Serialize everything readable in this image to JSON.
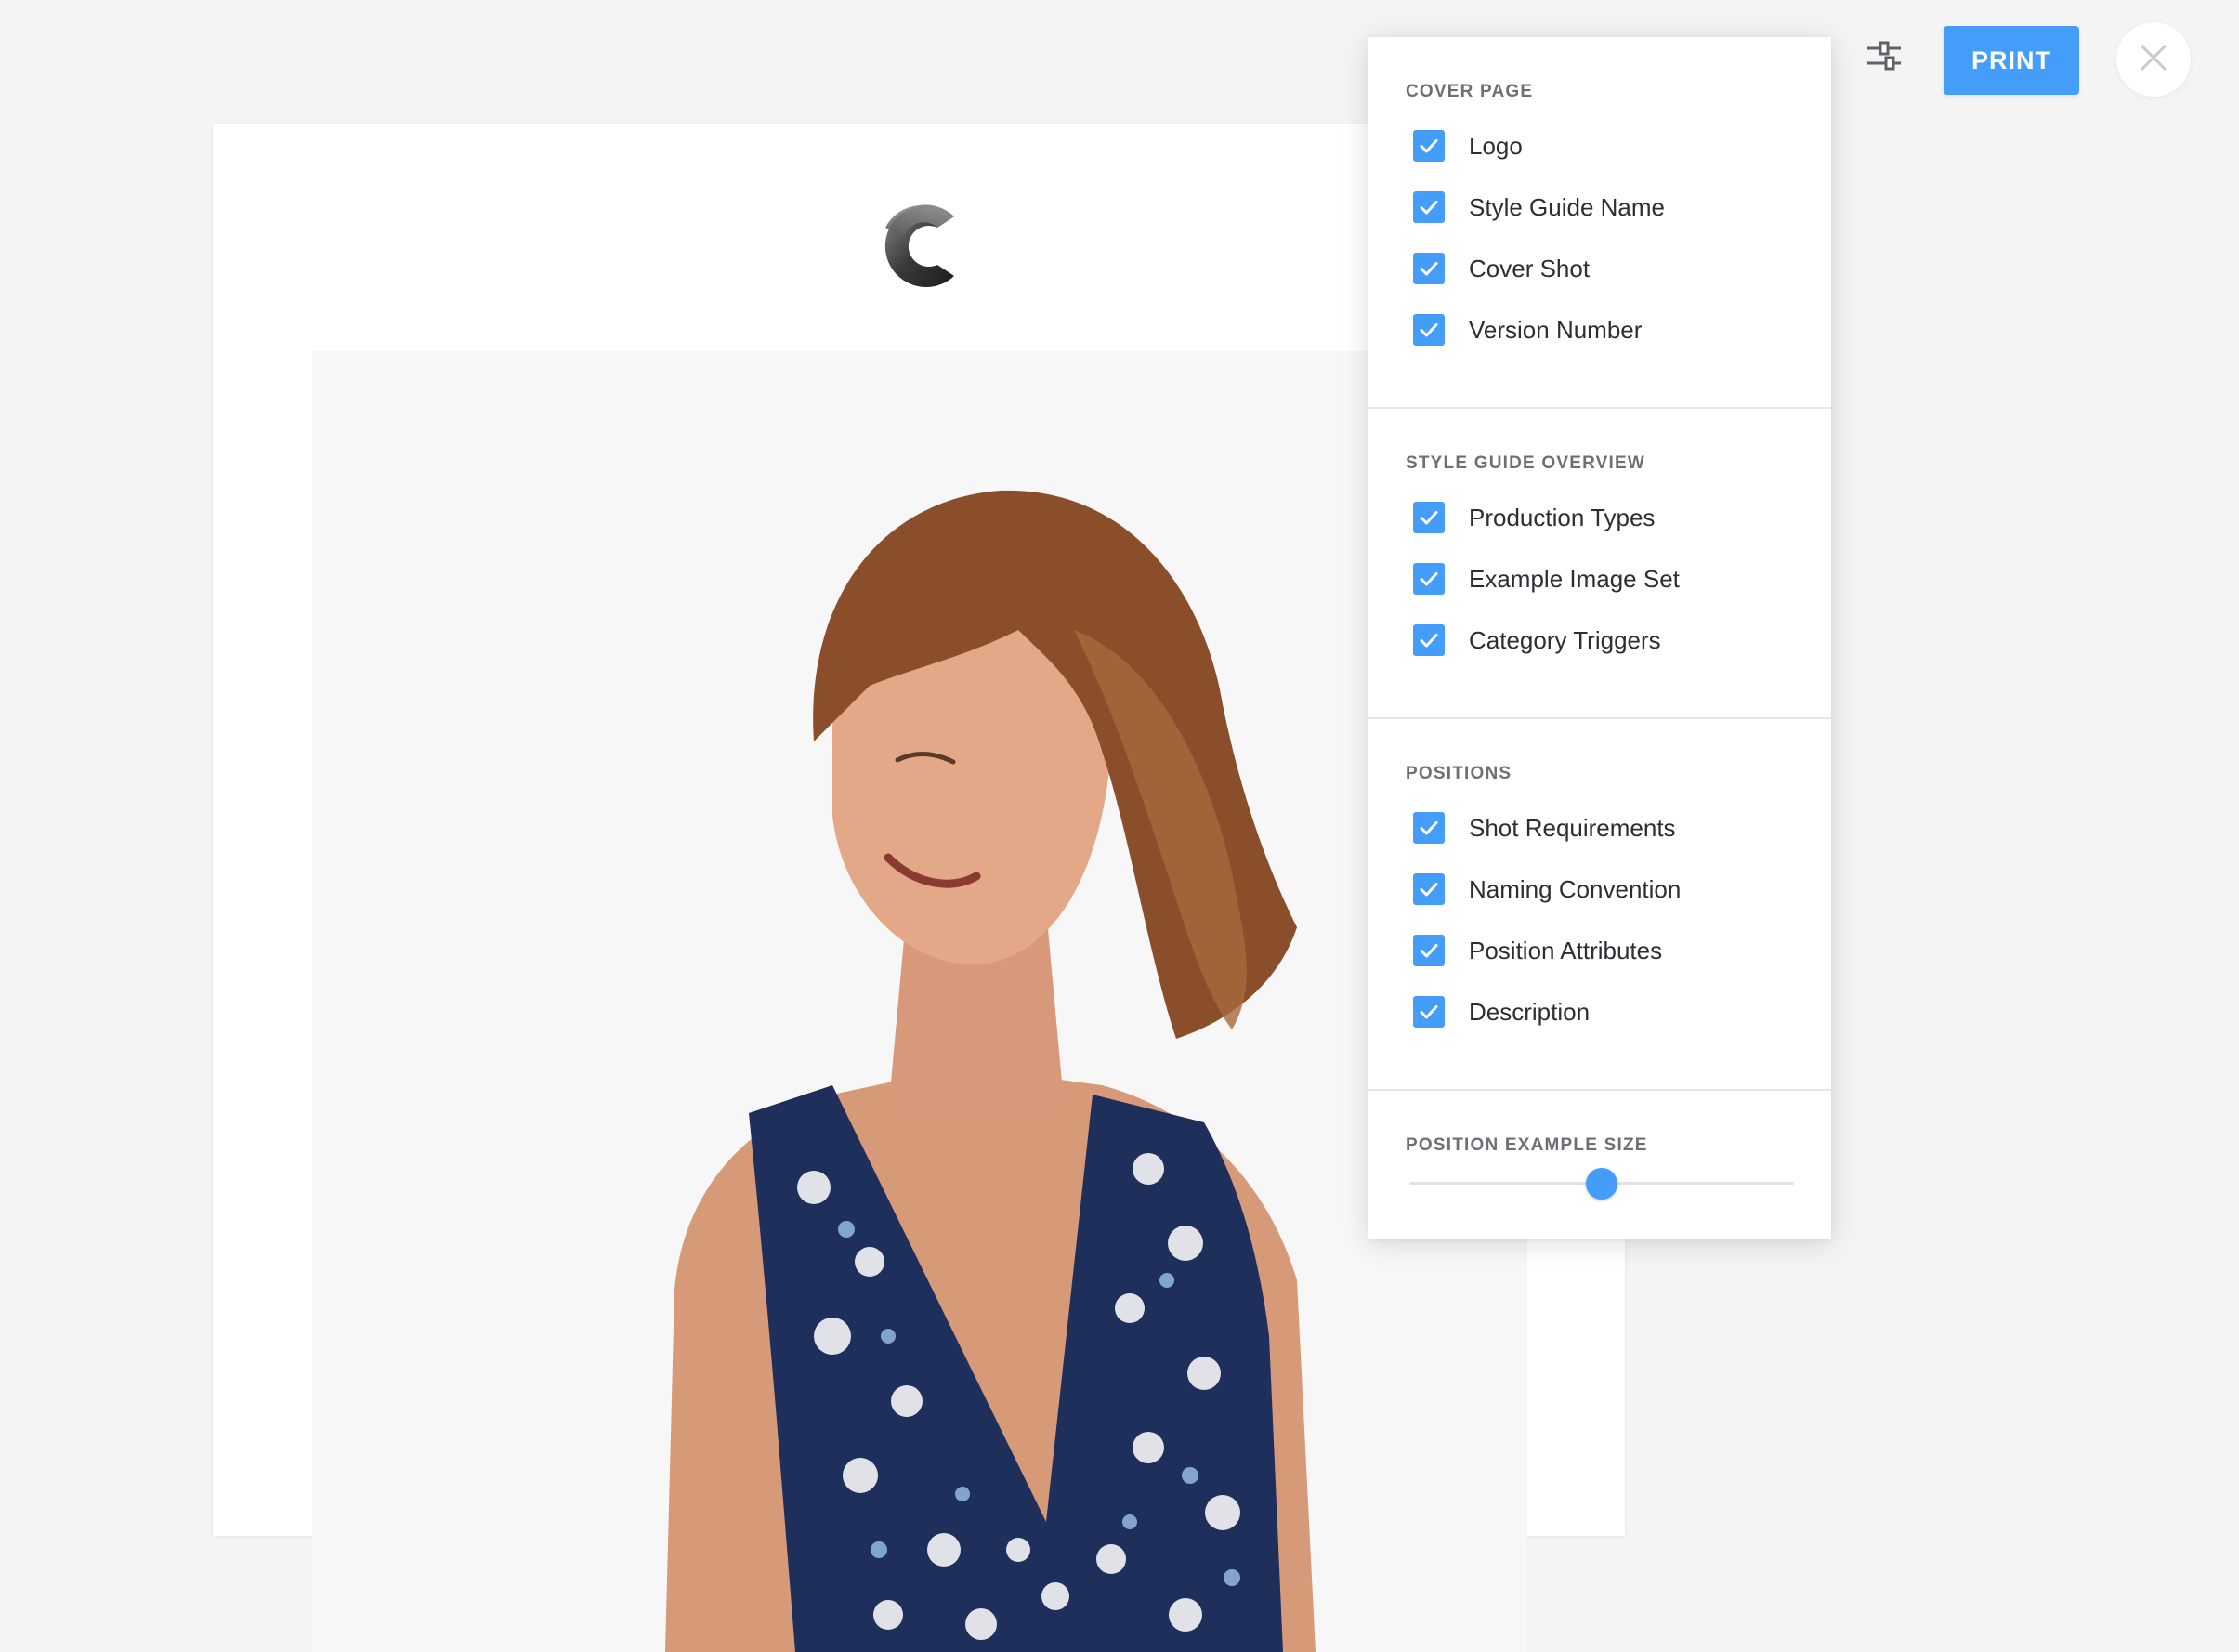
{
  "toolbar": {
    "print_label": "PRINT",
    "settings_icon": "sliders-icon",
    "close_icon": "close-icon"
  },
  "preview": {
    "logo_icon": "c-logo-icon"
  },
  "options": {
    "cover_page": {
      "title": "COVER PAGE",
      "items": [
        {
          "label": "Logo",
          "checked": true
        },
        {
          "label": "Style Guide Name",
          "checked": true
        },
        {
          "label": "Cover Shot",
          "checked": true
        },
        {
          "label": "Version Number",
          "checked": true
        }
      ]
    },
    "style_guide_overview": {
      "title": "STYLE GUIDE OVERVIEW",
      "items": [
        {
          "label": "Production Types",
          "checked": true
        },
        {
          "label": "Example Image Set",
          "checked": true
        },
        {
          "label": "Category Triggers",
          "checked": true
        }
      ]
    },
    "positions": {
      "title": "POSITIONS",
      "items": [
        {
          "label": "Shot Requirements",
          "checked": true
        },
        {
          "label": "Naming Convention",
          "checked": true
        },
        {
          "label": "Position Attributes",
          "checked": true
        },
        {
          "label": "Description",
          "checked": true
        }
      ]
    },
    "position_example_size": {
      "title": "POSITION EXAMPLE SIZE",
      "value_fraction": 0.5
    }
  },
  "colors": {
    "accent": "#449ef9",
    "background": "#f4f4f5",
    "panel": "#ffffff",
    "label_text": "#2c2e33",
    "section_title": "#6d6f75"
  }
}
